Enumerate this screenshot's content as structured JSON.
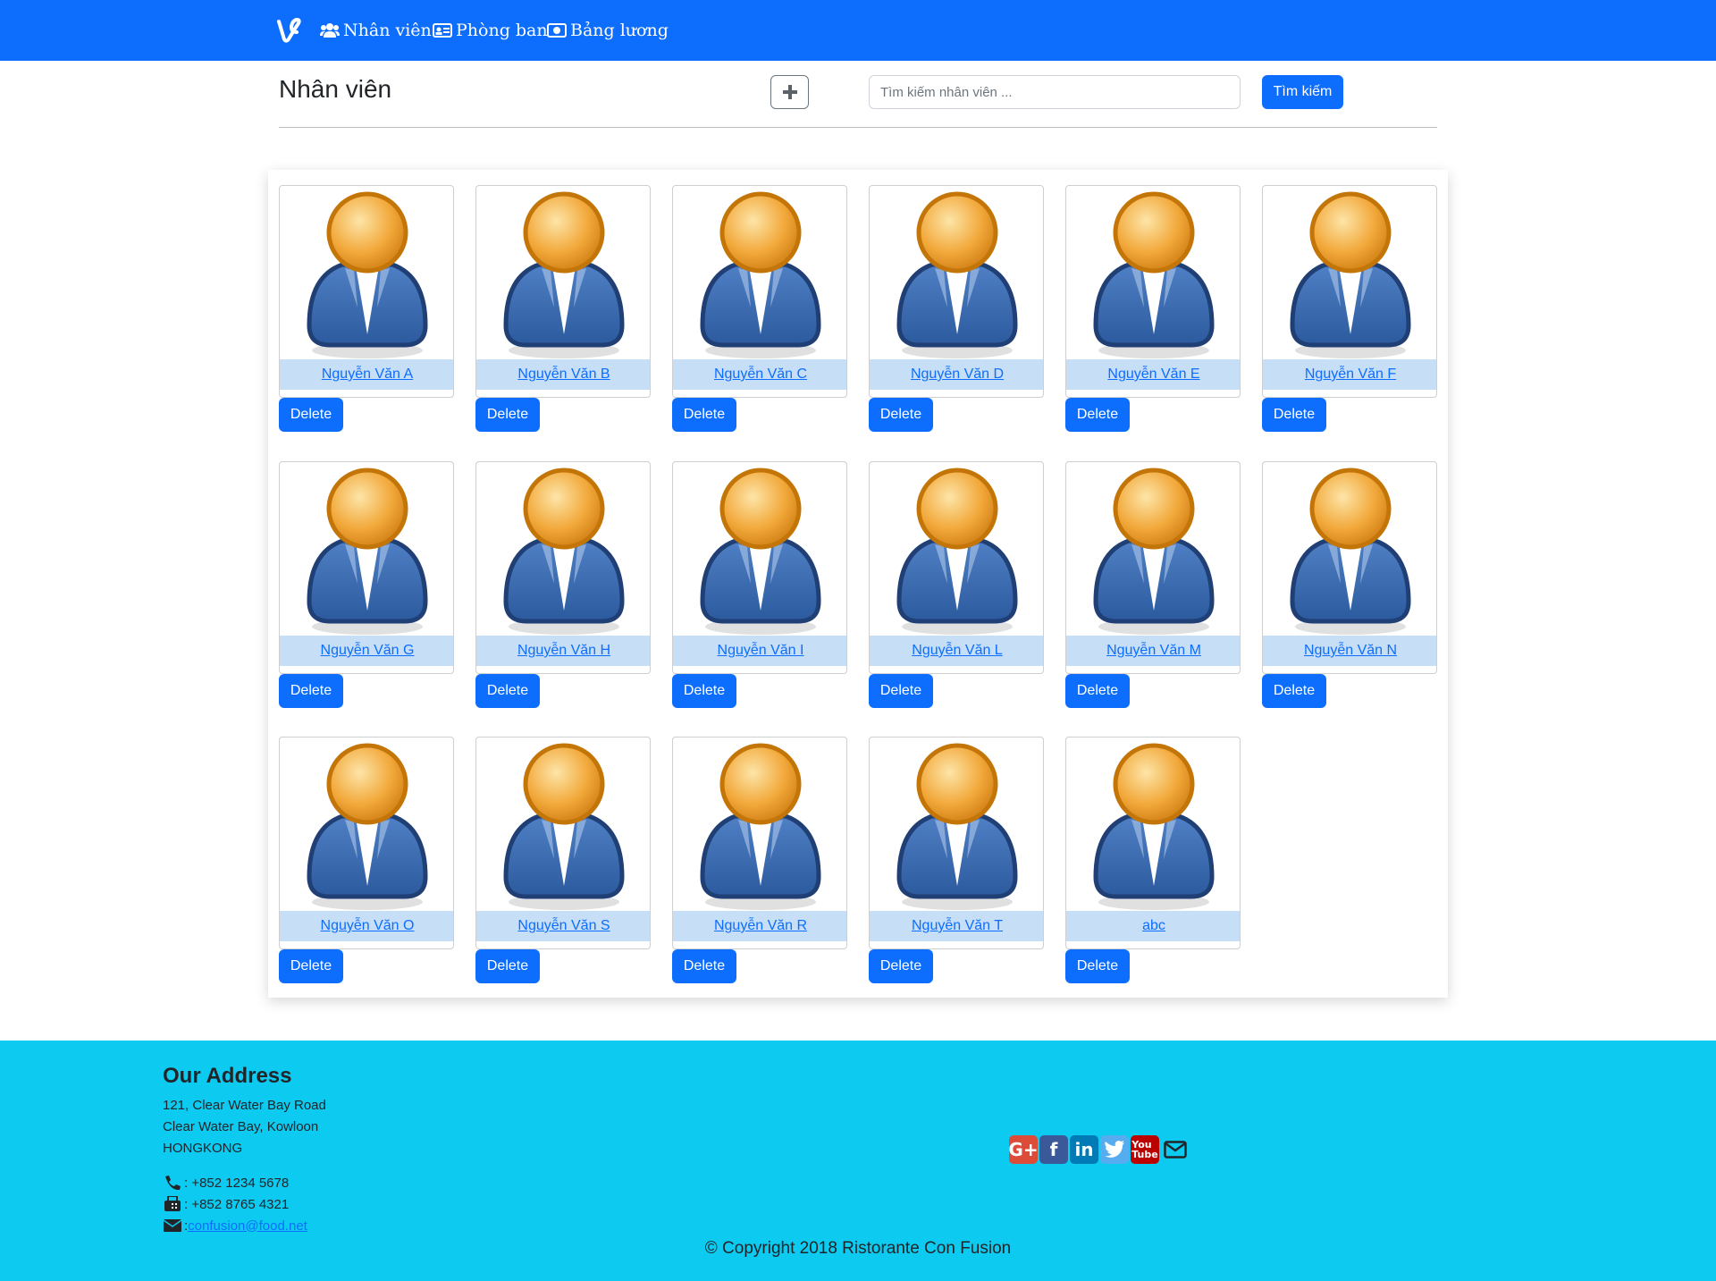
{
  "nav": {
    "items": [
      {
        "label": "Nhân viên",
        "icon": "users-icon"
      },
      {
        "label": "Phòng ban",
        "icon": "id-card-icon"
      },
      {
        "label": "Bảng lương",
        "icon": "money-bill-icon"
      }
    ]
  },
  "header": {
    "title": "Nhân viên",
    "search_placeholder": "Tìm kiếm nhân viên ...",
    "search_button": "Tìm kiếm"
  },
  "employees": [
    {
      "name": "Nguyễn Văn A"
    },
    {
      "name": "Nguyễn Văn B"
    },
    {
      "name": "Nguyễn Văn C"
    },
    {
      "name": "Nguyễn Văn D"
    },
    {
      "name": "Nguyễn Văn E"
    },
    {
      "name": "Nguyễn Văn F"
    },
    {
      "name": "Nguyễn Văn G"
    },
    {
      "name": "Nguyễn Văn H"
    },
    {
      "name": "Nguyễn Văn I"
    },
    {
      "name": "Nguyễn Văn L"
    },
    {
      "name": "Nguyễn Văn M"
    },
    {
      "name": "Nguyễn Văn N"
    },
    {
      "name": "Nguyễn Văn O"
    },
    {
      "name": "Nguyễn Văn S"
    },
    {
      "name": "Nguyễn Văn R"
    },
    {
      "name": "Nguyễn Văn T"
    },
    {
      "name": "abc"
    }
  ],
  "delete_label": "Delete",
  "footer": {
    "address_title": "Our Address",
    "address_lines": [
      "121, Clear Water Bay Road",
      "Clear Water Bay, Kowloon",
      "HONGKONG"
    ],
    "phone": ": +852 1234 5678",
    "fax": ": +852 8765 4321",
    "email_prefix": ":",
    "email": "confusion@food.net",
    "copyright": "© Copyright 2018 Ristorante Con Fusion"
  },
  "colors": {
    "primary": "#0d6efd",
    "footer_bg": "#0dcaf0",
    "name_bar": "#c7def7"
  }
}
